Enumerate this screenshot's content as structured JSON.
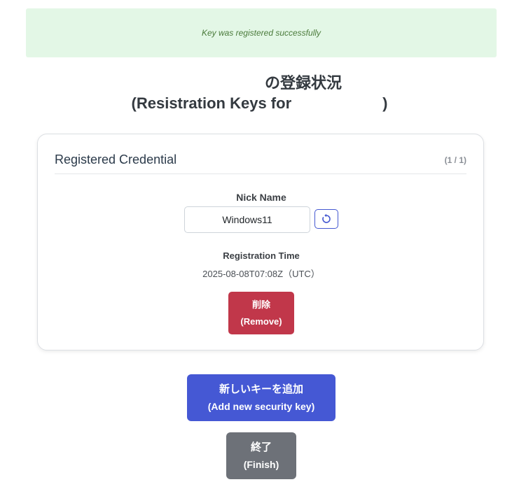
{
  "alert": {
    "message": "Key was registered successfully"
  },
  "heading": {
    "line1": "の登録状況",
    "line2_prefix": "(Resistration Keys for",
    "line2_suffix": ")"
  },
  "card": {
    "title": "Registered Credential",
    "count": "(1 / 1)",
    "nickname_label": "Nick Name",
    "nickname_value": "Windows11",
    "reset_icon": "reset-icon",
    "registration_label": "Registration Time",
    "registration_value": "2025-08-08T07:08Z（UTC）",
    "remove_label_ja": "削除",
    "remove_label_en": "(Remove)"
  },
  "actions": {
    "add_label_ja": "新しいキーを追加",
    "add_label_en": "(Add new security key)",
    "finish_label_ja": "終了",
    "finish_label_en": "(Finish)"
  },
  "colors": {
    "alert_bg": "#e3f7e6",
    "remove": "#c1374a",
    "primary": "#4558d4",
    "secondary": "#6d7178"
  }
}
